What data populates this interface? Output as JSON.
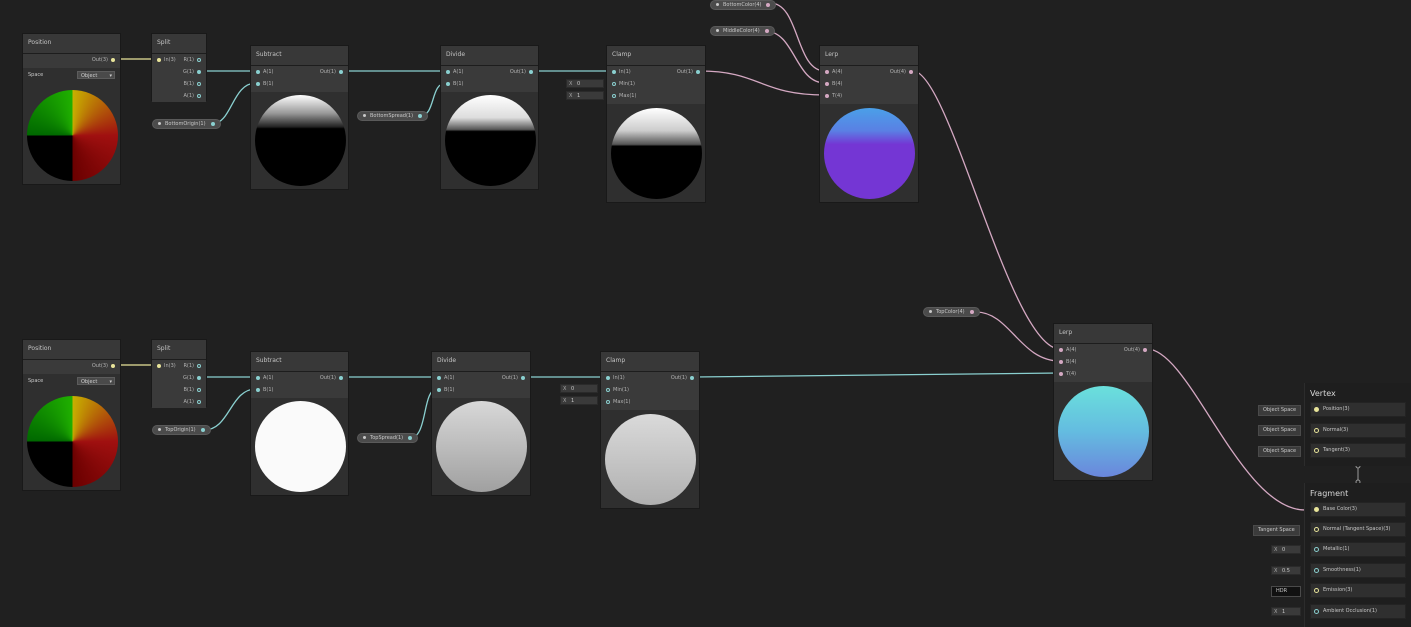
{
  "row1": {
    "position": {
      "title": "Position",
      "out": "Out(3)",
      "space_label": "Space",
      "space_value": "Object"
    },
    "split": {
      "title": "Split",
      "in": "In(3)",
      "outs": [
        "R(1)",
        "G(1)",
        "B(1)",
        "A(1)"
      ]
    },
    "subtract": {
      "title": "Subtract",
      "a": "A(1)",
      "b": "B(1)",
      "out": "Out(1)"
    },
    "divide": {
      "title": "Divide",
      "a": "A(1)",
      "b": "B(1)",
      "out": "Out(1)"
    },
    "clamp": {
      "title": "Clamp",
      "in": "In(1)",
      "min": "Min(1)",
      "max": "Max(1)",
      "out": "Out(1)",
      "min_value": "0",
      "max_value": "1",
      "x": "X"
    },
    "lerp": {
      "title": "Lerp",
      "a": "A(4)",
      "b": "B(4)",
      "t": "T(4)",
      "out": "Out(4)"
    },
    "props": {
      "bottom_origin": "BottomOrigin(1)",
      "bottom_spread": "BottomSpread(1)",
      "bottom_color": "BottomColor(4)",
      "middle_color": "MiddleColor(4)"
    }
  },
  "row2": {
    "position": {
      "title": "Position",
      "out": "Out(3)",
      "space_label": "Space",
      "space_value": "Object"
    },
    "split": {
      "title": "Split",
      "in": "In(3)",
      "outs": [
        "R(1)",
        "G(1)",
        "B(1)",
        "A(1)"
      ]
    },
    "subtract": {
      "title": "Subtract",
      "a": "A(1)",
      "b": "B(1)",
      "out": "Out(1)"
    },
    "divide": {
      "title": "Divide",
      "a": "A(1)",
      "b": "B(1)",
      "out": "Out(1)"
    },
    "clamp": {
      "title": "Clamp",
      "in": "In(1)",
      "min": "Min(1)",
      "max": "Max(1)",
      "out": "Out(1)",
      "min_value": "0",
      "max_value": "1",
      "x": "X"
    },
    "props": {
      "top_origin": "TopOrigin(1)",
      "top_spread": "TopSpread(1)"
    }
  },
  "lerp2": {
    "title": "Lerp",
    "a": "A(4)",
    "b": "B(4)",
    "t": "T(4)",
    "out": "Out(4)"
  },
  "top_color": "TopColor(4)",
  "vertex": {
    "title": "Vertex",
    "slots": [
      {
        "tag": "Object Space",
        "label": "Position(3)"
      },
      {
        "tag": "Object Space",
        "label": "Normal(3)"
      },
      {
        "tag": "Object Space",
        "label": "Tangent(3)"
      }
    ]
  },
  "fragment": {
    "title": "Fragment",
    "slots": [
      {
        "tag": "",
        "label": "Base Color(3)"
      },
      {
        "tag": "Tangent Space",
        "label": "Normal (Tangent Space)(3)"
      },
      {
        "tag": "0",
        "label": "Metallic(1)",
        "x": "X"
      },
      {
        "tag": "0.5",
        "label": "Smoothness(1)",
        "x": "X"
      },
      {
        "tag": "HDR",
        "label": "Emission(3)"
      },
      {
        "tag": "1",
        "label": "Ambient Occlusion(1)",
        "x": "X"
      }
    ]
  },
  "colors": {
    "background": "#202020",
    "wire_float": "#8ad0d0",
    "wire_vector3": "#e8e49a",
    "wire_vector4": "#d4a8c2",
    "lerp1_top": "#4aa0e8",
    "lerp1_bottom": "#7436d4",
    "lerp2_top": "#6ae0dc",
    "lerp2_bottom": "#6a86dc"
  }
}
